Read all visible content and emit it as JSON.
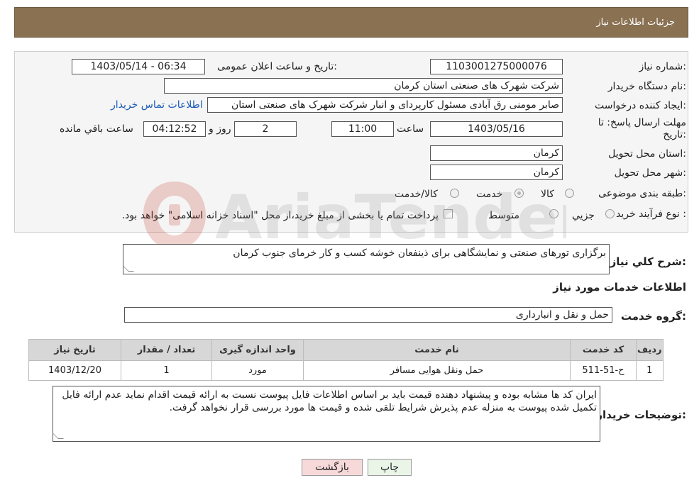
{
  "header": {
    "title": "جزئیات اطلاعات نیاز"
  },
  "form": {
    "need_number": {
      "label": "شماره نیاز:",
      "value": "1103001275000076"
    },
    "announce": {
      "label": "تاریخ و ساعت اعلان عمومی:",
      "value": "1403/05/14 - 06:34"
    },
    "buyer_org": {
      "label": "نام دستگاه خریدار:",
      "value": "شرکت شهرک های صنعتی استان کرمان"
    },
    "requester": {
      "label": "ایجاد کننده درخواست:",
      "value": "صابر مومنی رق آبادی مسئول کارپردای و انبار شرکت شهرک های صنعتی استان",
      "contact_link": "اطلاعات تماس خریدار"
    },
    "deadline": {
      "label_line1": "مهلت ارسال پاسخ: تا",
      "label_line2": "تاریخ:",
      "date": "1403/05/16",
      "time_label": "ساعت",
      "time": "11:00",
      "days": "2",
      "days_label": "روز و",
      "remaining": "04:12:52",
      "remaining_label": "ساعت باقي مانده"
    },
    "province": {
      "label": "استان محل تحویل:",
      "value": "کرمان"
    },
    "city": {
      "label": "شهر محل تحویل:",
      "value": "کرمان"
    },
    "category": {
      "label": "طبقه بندی موضوعی:",
      "options": [
        "کالا",
        "خدمت",
        "کالا/خدمت"
      ],
      "selected": "خدمت"
    },
    "process": {
      "label": "نوع فرآیند خرید :",
      "options": [
        "جزیي",
        "متوسط"
      ],
      "note": "پرداخت تمام یا بخشی از مبلغ خرید،از محل \"اسناد خزانه اسلامی\" خواهد بود."
    },
    "summary": {
      "label": "شرح کلي نياز:",
      "value": "برگزاری تورهای صنعتی و نمایشگاهی برای ذینفعان خوشه کسب و کار خرمای جنوب کرمان"
    }
  },
  "services": {
    "section_title": "اطلاعات خدمات مورد نیاز",
    "group_label": "گروه خدمت:",
    "group_value": "حمل و نقل و انبارداری",
    "columns": [
      "ردیف",
      "کد خدمت",
      "نام خدمت",
      "واحد اندازه گیری",
      "تعداد / مقدار",
      "تاریخ نیاز"
    ],
    "rows": [
      [
        "1",
        "ح-51-511",
        "حمل ونقل هوایی مسافر",
        "مورد",
        "1",
        "1403/12/20"
      ]
    ]
  },
  "buyer_notes": {
    "label": "توضیحات خریدار:",
    "value": "ایران کد ها مشابه بوده و پیشنهاد دهنده قیمت باید بر اساس اطلاعات فایل پیوست نسبت به ارائه قیمت اقدام نماید عدم ارائه فایل تکمیل شده پیوست به منزله عدم پذیرش شرایط تلقی شده و قیمت ها مورد بررسی قرار نخواهد گرفت."
  },
  "buttons": {
    "print": "چاپ",
    "back": "بازگشت"
  },
  "watermark": {
    "text": "AriaTender.neT"
  }
}
